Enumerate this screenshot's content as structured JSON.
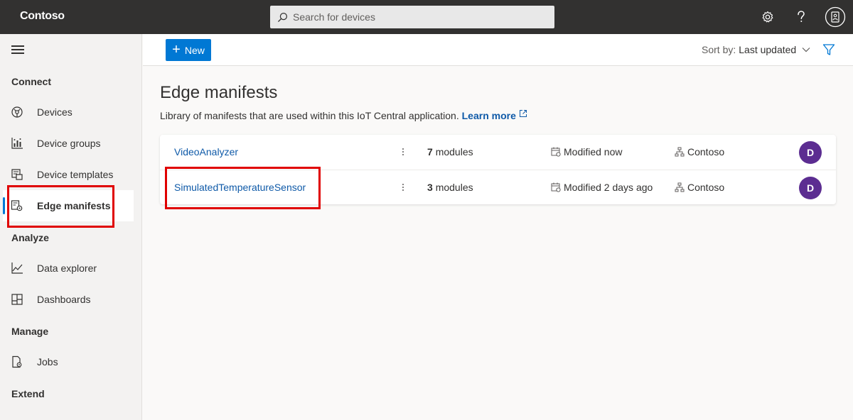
{
  "app": {
    "brand": "Contoso"
  },
  "search": {
    "placeholder": "Search for devices"
  },
  "sidebar": {
    "sections": {
      "connect": "Connect",
      "analyze": "Analyze",
      "manage": "Manage",
      "extend": "Extend"
    },
    "items": [
      {
        "label": "Devices",
        "icon": "devices-icon"
      },
      {
        "label": "Device groups",
        "icon": "device-groups-icon"
      },
      {
        "label": "Device templates",
        "icon": "device-templates-icon"
      },
      {
        "label": "Edge manifests",
        "icon": "edge-manifests-icon",
        "active": true
      },
      {
        "label": "Data explorer",
        "icon": "data-explorer-icon"
      },
      {
        "label": "Dashboards",
        "icon": "dashboards-icon"
      },
      {
        "label": "Jobs",
        "icon": "jobs-icon"
      }
    ]
  },
  "toolbar": {
    "new_label": "New",
    "sort_prefix": "Sort by:",
    "sort_value": "Last updated"
  },
  "main": {
    "title": "Edge manifests",
    "description": "Library of manifests that are used within this IoT Central application.",
    "learn_more": "Learn more",
    "rows": [
      {
        "name": "VideoAnalyzer",
        "modules_count": "7",
        "modules_label": "modules",
        "modified": "Modified now",
        "org": "Contoso",
        "avatar": "D"
      },
      {
        "name": "SimulatedTemperatureSensor",
        "modules_count": "3",
        "modules_label": "modules",
        "modified": "Modified 2 days ago",
        "org": "Contoso",
        "avatar": "D"
      }
    ]
  },
  "colors": {
    "accent": "#0078d4",
    "topbar": "#323130",
    "highlight": "#e00000",
    "avatar": "#5c2d91",
    "link": "#0f5aa8"
  }
}
